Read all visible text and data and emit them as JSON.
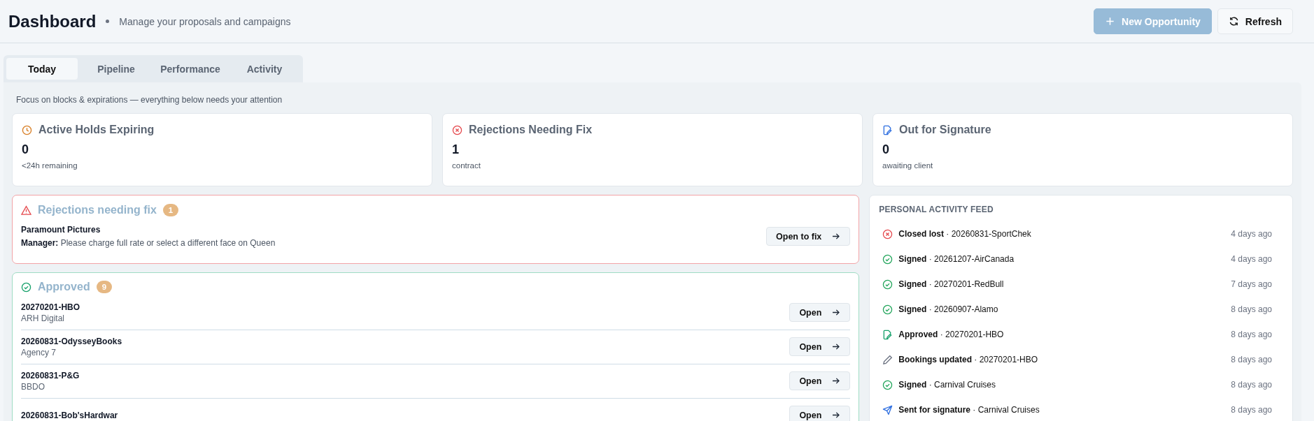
{
  "header": {
    "title": "Dashboard",
    "subtitle": "Manage your proposals and campaigns",
    "buttons": [
      {
        "kind": "primary",
        "label": "New Opportunity",
        "disabled": true
      },
      {
        "kind": "refresh",
        "label": "Refresh",
        "disabled": false
      }
    ]
  },
  "tabs": [
    {
      "label": "Today",
      "selected": true
    },
    {
      "label": "Pipeline",
      "selected": false
    },
    {
      "label": "Performance",
      "selected": false
    },
    {
      "label": "Activity",
      "selected": false
    }
  ],
  "focus_note": "Focus on blocks & expirations — everything below needs your attention",
  "stat_cards": [
    {
      "kind": "clock",
      "title": "Active Holds Expiring",
      "value": "0",
      "caption": "<24h remaining"
    },
    {
      "kind": "rejected",
      "title": "Rejections Needing Fix",
      "value": "1",
      "caption": "contract"
    },
    {
      "kind": "signature",
      "title": "Out for Signature",
      "value": "0",
      "caption": "awaiting client"
    }
  ],
  "rejections": {
    "title": "Rejections needing fix",
    "count": "1",
    "items": [
      {
        "client": "Paramount Pictures",
        "note": "**Manager:** Please charge full rate or select a different face on Queen",
        "action": "Open to fix"
      }
    ]
  },
  "approved": {
    "title": "Approved",
    "count": "9",
    "items": [
      {
        "name": "20270201-HBO",
        "agency": "ARH Digital",
        "action": "Open"
      },
      {
        "name": "20260831-OdysseyBooks",
        "agency": "Agency 7",
        "action": "Open"
      },
      {
        "name": "20260831-P&G",
        "agency": "BBDO",
        "action": "Open"
      },
      {
        "name": "20260831-Bob'sHardwar",
        "action": "Open"
      }
    ]
  },
  "activity_feed": {
    "title": "PERSONAL ACTIVITY FEED",
    "items": [
      {
        "kind": "lost",
        "text": "**Closed lost** · 20260831-SportChek",
        "time": "4 days ago"
      },
      {
        "kind": "signed",
        "text": "**Signed** · 20261207-AirCanada",
        "time": "4 days ago"
      },
      {
        "kind": "signed",
        "text": "**Signed** · 20270201-RedBull",
        "time": "7 days ago"
      },
      {
        "kind": "signed",
        "text": "**Signed** · 20260907-Alamo",
        "time": "8 days ago"
      },
      {
        "kind": "approved",
        "text": "**Approved** · 20270201-HBO",
        "time": "8 days ago"
      },
      {
        "kind": "edited",
        "text": "**Bookings updated** · 20270201-HBO",
        "time": "8 days ago"
      },
      {
        "kind": "signed",
        "text": "**Signed** · Carnival Cruises",
        "time": "8 days ago"
      },
      {
        "kind": "sent",
        "text": "**Sent for signature** · Carnival Cruises",
        "time": "8 days ago"
      }
    ]
  }
}
